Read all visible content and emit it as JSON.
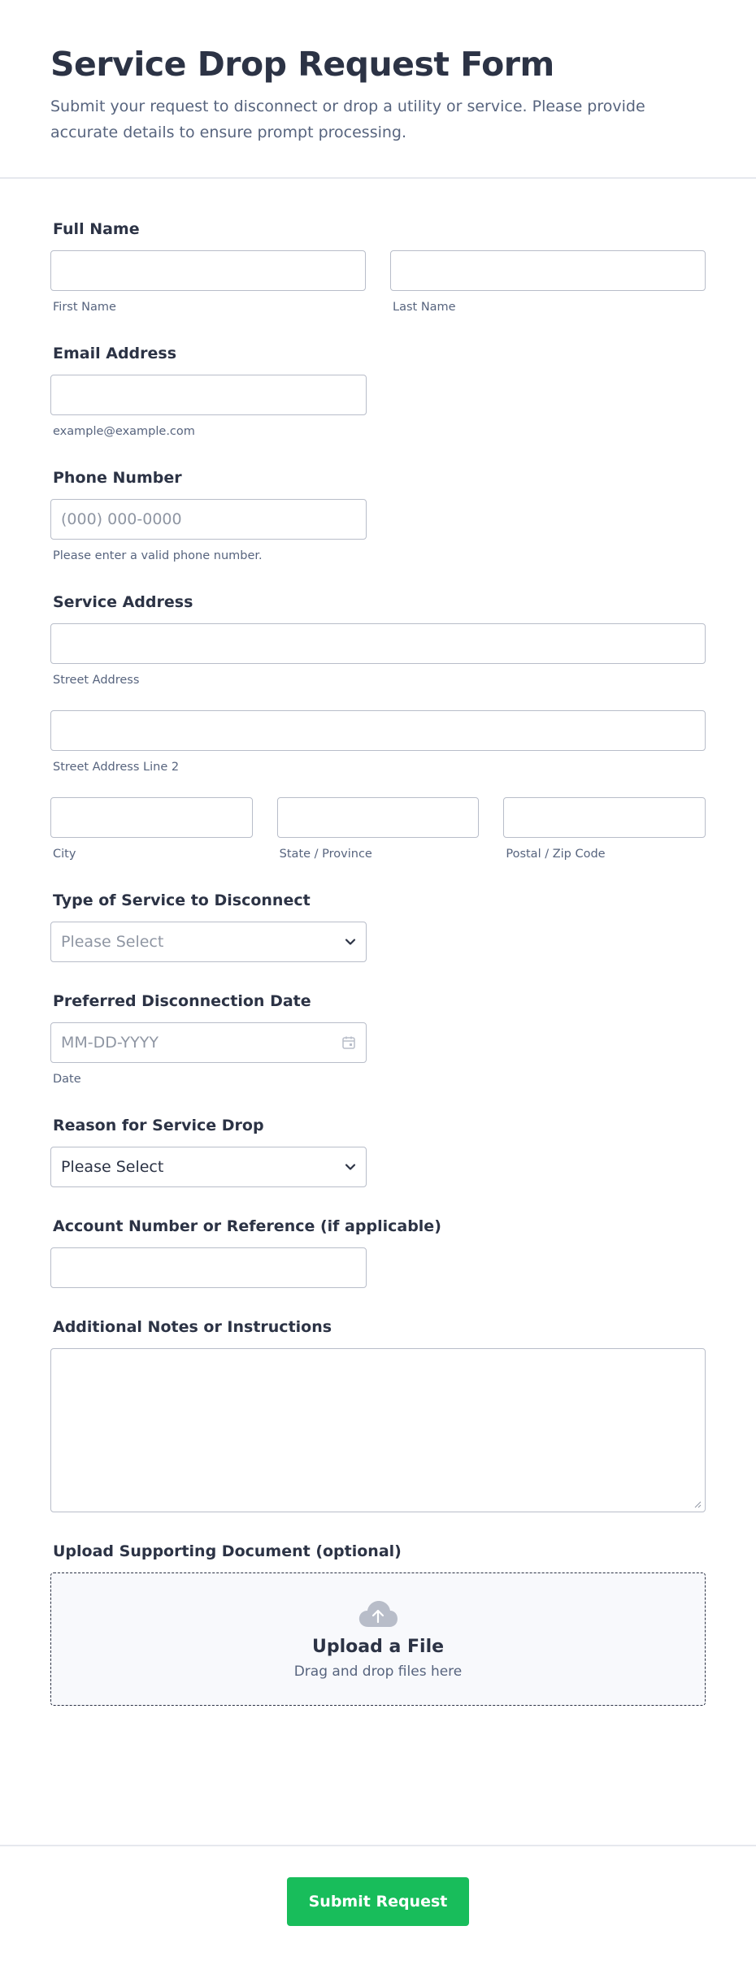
{
  "header": {
    "title": "Service Drop Request Form",
    "subtitle": "Submit your request to disconnect or drop a utility or service. Please provide accurate details to ensure prompt processing."
  },
  "full_name": {
    "label": "Full Name",
    "first_sublabel": "First Name",
    "last_sublabel": "Last Name"
  },
  "email": {
    "label": "Email Address",
    "sublabel": "example@example.com"
  },
  "phone": {
    "label": "Phone Number",
    "placeholder": "(000) 000-0000",
    "sublabel": "Please enter a valid phone number."
  },
  "address": {
    "label": "Service Address",
    "street_sublabel": "Street Address",
    "street2_sublabel": "Street Address Line 2",
    "city_sublabel": "City",
    "state_sublabel": "State / Province",
    "zip_sublabel": "Postal / Zip Code"
  },
  "service_type": {
    "label": "Type of Service to Disconnect",
    "placeholder": "Please Select"
  },
  "date": {
    "label": "Preferred Disconnection Date",
    "placeholder": "MM-DD-YYYY",
    "sublabel": "Date"
  },
  "reason": {
    "label": "Reason for Service Drop",
    "value": "Please Select"
  },
  "account": {
    "label": "Account Number or Reference (if applicable)"
  },
  "notes": {
    "label": "Additional Notes or Instructions"
  },
  "upload": {
    "label": "Upload Supporting Document (optional)",
    "title": "Upload a File",
    "subtitle": "Drag and drop files here"
  },
  "submit": {
    "label": "Submit Request"
  },
  "colors": {
    "accent": "#18bd5b",
    "text": "#2c3345",
    "muted": "#57647e",
    "border": "#b8bdc9"
  },
  "icons": {
    "select": "chevron-down-icon",
    "date": "calendar-icon",
    "upload": "cloud-upload-icon"
  }
}
